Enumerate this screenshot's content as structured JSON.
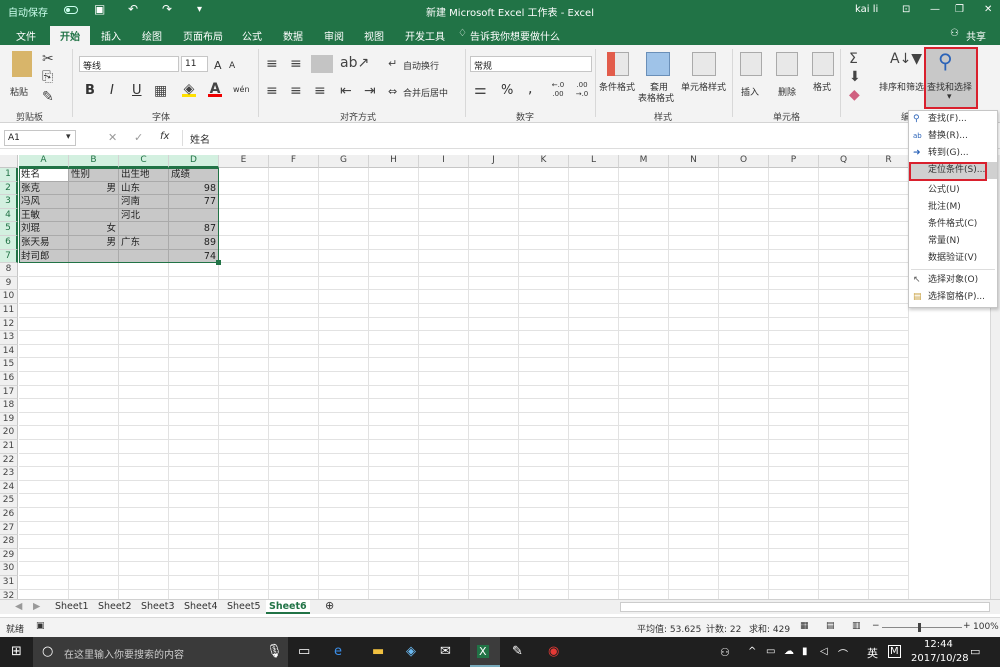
{
  "titlebar": {
    "autosave": "自动保存",
    "title": "新建 Microsoft Excel 工作表 - Excel",
    "user": "kai li",
    "minimize": "—",
    "restore": "❐",
    "close": "✕"
  },
  "tabs": [
    "文件",
    "开始",
    "插入",
    "绘图",
    "页面布局",
    "公式",
    "数据",
    "审阅",
    "视图",
    "开发工具"
  ],
  "tell_me": "告诉我你想要做什么",
  "share": "共享",
  "ribbon": {
    "clipboard": {
      "paste": "粘贴",
      "label": "剪贴板"
    },
    "font": {
      "name": "等线",
      "size": "11",
      "bold": "B",
      "italic": "I",
      "underline": "U",
      "grow": "A",
      "shrink": "A",
      "label": "字体"
    },
    "alignment": {
      "wrap": "自动换行",
      "merge": "合并后居中",
      "label": "对齐方式"
    },
    "number": {
      "format": "常规",
      "percent": "%",
      "comma": ",",
      "inc": "←.0 .00",
      "dec": ".00 →.0",
      "label": "数字"
    },
    "styles": {
      "conditional": "条件格式",
      "table_1": "套用",
      "table_2": "表格格式",
      "cell": "单元格样式",
      "label": "样式"
    },
    "cells": {
      "insert": "插入",
      "delete": "删除",
      "format": "格式",
      "label": "单元格"
    },
    "editing": {
      "sort": "排序和筛选",
      "find": "查找和选择",
      "label": "编"
    }
  },
  "formula_bar": {
    "name_box": "A1",
    "fx": "fx",
    "content": "姓名"
  },
  "columns": [
    "A",
    "B",
    "C",
    "D",
    "E",
    "F",
    "G",
    "H",
    "I",
    "J",
    "K",
    "L",
    "M",
    "N",
    "O",
    "P",
    "Q",
    "R"
  ],
  "table": [
    [
      "姓名",
      "性别",
      "出生地",
      "成绩"
    ],
    [
      "张克",
      "男",
      "山东",
      "98"
    ],
    [
      "冯风",
      "",
      "河南",
      "77"
    ],
    [
      "王敏",
      "",
      "河北",
      ""
    ],
    [
      "刘琨",
      "女",
      "",
      "87"
    ],
    [
      "张天易",
      "男",
      "广东",
      "89"
    ],
    [
      "封司郎",
      "",
      "",
      "74"
    ]
  ],
  "rows": [
    "1",
    "2",
    "3",
    "4",
    "5",
    "6",
    "7",
    "8",
    "9",
    "10",
    "11",
    "12",
    "13",
    "14",
    "15",
    "16",
    "17",
    "18",
    "19",
    "20",
    "21",
    "22",
    "23",
    "24",
    "25",
    "26",
    "27",
    "28",
    "29",
    "30",
    "31",
    "32"
  ],
  "menu": [
    {
      "label": "查找(F)...",
      "icon": "search-icon"
    },
    {
      "label": "替换(R)...",
      "icon": "replace-icon"
    },
    {
      "label": "转到(G)...",
      "icon": "arrow-right-icon"
    },
    {
      "label": "定位条件(S)...",
      "icon": ""
    },
    {
      "label": "公式(U)",
      "icon": ""
    },
    {
      "label": "批注(M)",
      "icon": ""
    },
    {
      "label": "条件格式(C)",
      "icon": ""
    },
    {
      "label": "常量(N)",
      "icon": ""
    },
    {
      "label": "数据验证(V)",
      "icon": ""
    },
    {
      "label": "选择对象(O)",
      "icon": "cursor-icon"
    },
    {
      "label": "选择窗格(P)...",
      "icon": "pane-icon"
    }
  ],
  "sheets": [
    "Sheet1",
    "Sheet2",
    "Sheet3",
    "Sheet4",
    "Sheet5",
    "Sheet6"
  ],
  "active_sheet": "Sheet6",
  "status": {
    "ready": "就绪",
    "average": "平均值: 53.625",
    "count": "计数: 22",
    "sum": "求和: 429",
    "zoom": "100%"
  },
  "taskbar": {
    "search": "在这里输入你要搜索的内容",
    "ime": "英",
    "ime2": "M",
    "time": "12:44",
    "date": "2017/10/28"
  },
  "colors": {
    "excel_green": "#217346",
    "highlight_red": "#d9202d"
  }
}
